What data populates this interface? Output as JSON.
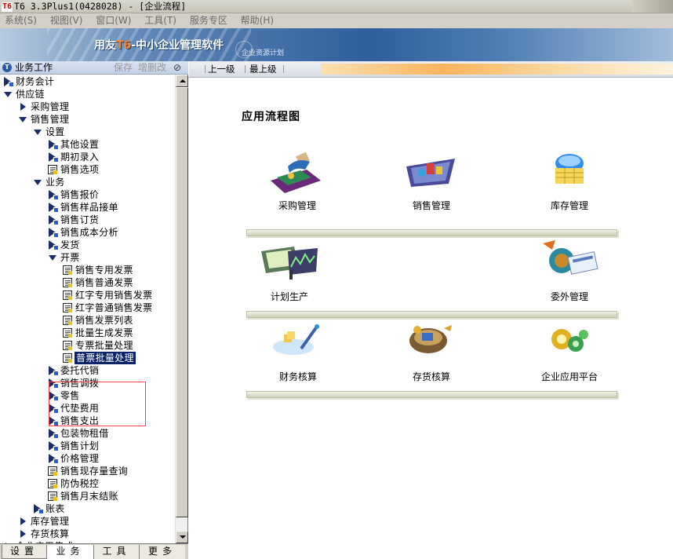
{
  "window": {
    "logo": "T6",
    "title": "T6 3.3Plus1(0428028) - [企业流程]"
  },
  "menu": [
    "系统(S)",
    "视图(V)",
    "窗口(W)",
    "工具(T)",
    "服务专区",
    "帮助(H)"
  ],
  "banner": {
    "brand_prefix": "用友",
    "brand_t6": "T6",
    "brand_suffix": "-中小企业管理软件",
    "subtitle": "企业资源计划"
  },
  "left_panel": {
    "title": "业务工作",
    "save": "保存",
    "delete": "增删改"
  },
  "tree": [
    {
      "label": "财务会计",
      "icon": "arr"
    },
    {
      "label": "供应链",
      "icon": "exp"
    },
    {
      "label": "采购管理",
      "icon": "col"
    },
    {
      "label": "销售管理",
      "icon": "exp"
    },
    {
      "label": "设置",
      "icon": "exp"
    },
    {
      "label": "其他设置",
      "icon": "arr"
    },
    {
      "label": "期初录入",
      "icon": "arr"
    },
    {
      "label": "销售选项",
      "icon": "doc"
    },
    {
      "label": "业务",
      "icon": "exp"
    },
    {
      "label": "销售报价",
      "icon": "arr"
    },
    {
      "label": "销售样品接单",
      "icon": "arr"
    },
    {
      "label": "销售订货",
      "icon": "arr"
    },
    {
      "label": "销售成本分析",
      "icon": "arr"
    },
    {
      "label": "发货",
      "icon": "arr"
    },
    {
      "label": "开票",
      "icon": "exp"
    },
    {
      "label": "销售专用发票",
      "icon": "doc"
    },
    {
      "label": "销售普通发票",
      "icon": "doc"
    },
    {
      "label": "红字专用销售发票",
      "icon": "doc"
    },
    {
      "label": "红字普通销售发票",
      "icon": "doc"
    },
    {
      "label": "销售发票列表",
      "icon": "doc"
    },
    {
      "label": "批量生成发票",
      "icon": "doc"
    },
    {
      "label": "专票批量处理",
      "icon": "doc"
    },
    {
      "label": "普票批量处理",
      "icon": "doc",
      "selected": true
    },
    {
      "label": "委托代销",
      "icon": "arr"
    },
    {
      "label": "销售调拨",
      "icon": "arr"
    },
    {
      "label": "零售",
      "icon": "arr"
    },
    {
      "label": "代垫费用",
      "icon": "arr"
    },
    {
      "label": "销售支出",
      "icon": "arr"
    },
    {
      "label": "包装物租借",
      "icon": "arr"
    },
    {
      "label": "销售计划",
      "icon": "arr"
    },
    {
      "label": "价格管理",
      "icon": "arr"
    },
    {
      "label": "销售现存量查询",
      "icon": "doc"
    },
    {
      "label": "防伪税控",
      "icon": "doc"
    },
    {
      "label": "销售月末结账",
      "icon": "doc"
    },
    {
      "label": "账表",
      "icon": "arr"
    },
    {
      "label": "库存管理",
      "icon": "col"
    },
    {
      "label": "存货核算",
      "icon": "col"
    },
    {
      "label": "企业应用集成",
      "icon": "col"
    }
  ],
  "bottom_tabs": [
    "设置",
    "业务",
    "工具",
    "更多"
  ],
  "toolbar": {
    "prev": "上一级",
    "top": "最上级"
  },
  "flow": {
    "title": "应用流程图",
    "modules": [
      {
        "label": "采购管理",
        "icon": "purchase-icon"
      },
      {
        "label": "销售管理",
        "icon": "sales-icon"
      },
      {
        "label": "库存管理",
        "icon": "inventory-icon"
      },
      {
        "label": "计划生产",
        "icon": "production-icon"
      },
      {
        "label": "委外管理",
        "icon": "outsourcing-icon"
      },
      {
        "label": "财务核算",
        "icon": "finance-icon"
      },
      {
        "label": "存货核算",
        "icon": "stock-accounting-icon"
      },
      {
        "label": "企业应用平台",
        "icon": "platform-icon"
      }
    ]
  }
}
